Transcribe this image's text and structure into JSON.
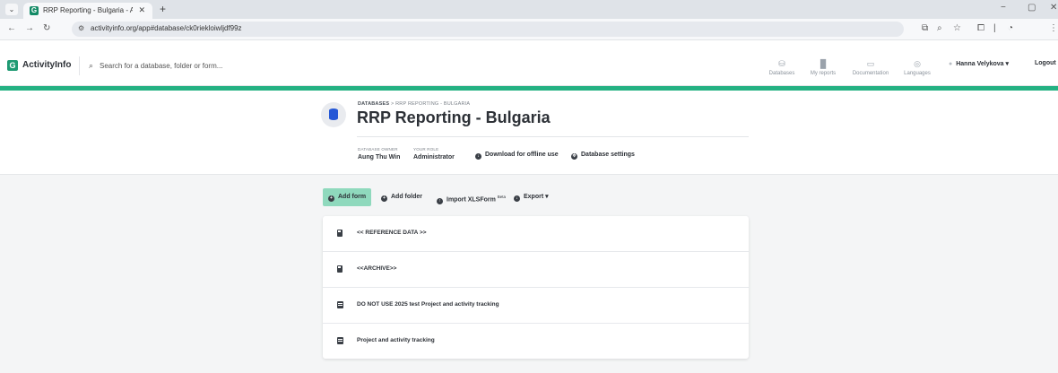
{
  "browser": {
    "tab_title": "RRP Reporting - Bulgaria - Acti",
    "tab_favicon": "ActivityInfo logo",
    "tab_close_icon": "close-icon",
    "url": "activityinfo.org/app#database/ck0riekloiwljdf99z"
  },
  "app": {
    "brand_name": "ActivityInfo",
    "brand_color": "#24b182",
    "search_placeholder": "Search for a database, folder or form...",
    "nav": [
      {
        "label": "Databases",
        "icon": "database-icon"
      },
      {
        "label": "My reports",
        "icon": "chart-icon"
      },
      {
        "label": "Documentation",
        "icon": "book-icon"
      },
      {
        "label": "Languages",
        "icon": "globe-icon"
      }
    ],
    "user_name": "Hanna Velykova",
    "logout_label": "Logout"
  },
  "database": {
    "breadcrumb_root": "DATABASES",
    "breadcrumb_separator": ">",
    "breadcrumb_current": "RRP REPORTING - BULGARIA",
    "title": "RRP Reporting - Bulgaria",
    "owner_label": "DATABASE OWNER",
    "owner_value": "Aung Thu Win",
    "role_label": "YOUR ROLE",
    "role_value": "Administrator",
    "download_label": "Download for offline use",
    "settings_label": "Database settings"
  },
  "toolbar": {
    "add_form": "Add form",
    "add_folder": "Add folder",
    "import_label": "Import XLSForm",
    "import_badge": "Beta",
    "export_label": "Export"
  },
  "items": [
    {
      "label": "<< REFERENCE DATA >>",
      "kind": "folder"
    },
    {
      "label": "<<ARCHIVE>>",
      "kind": "folder"
    },
    {
      "label": "DO NOT USE 2025 test Project and activity tracking",
      "kind": "form"
    },
    {
      "label": "Project and activity tracking",
      "kind": "form"
    }
  ]
}
